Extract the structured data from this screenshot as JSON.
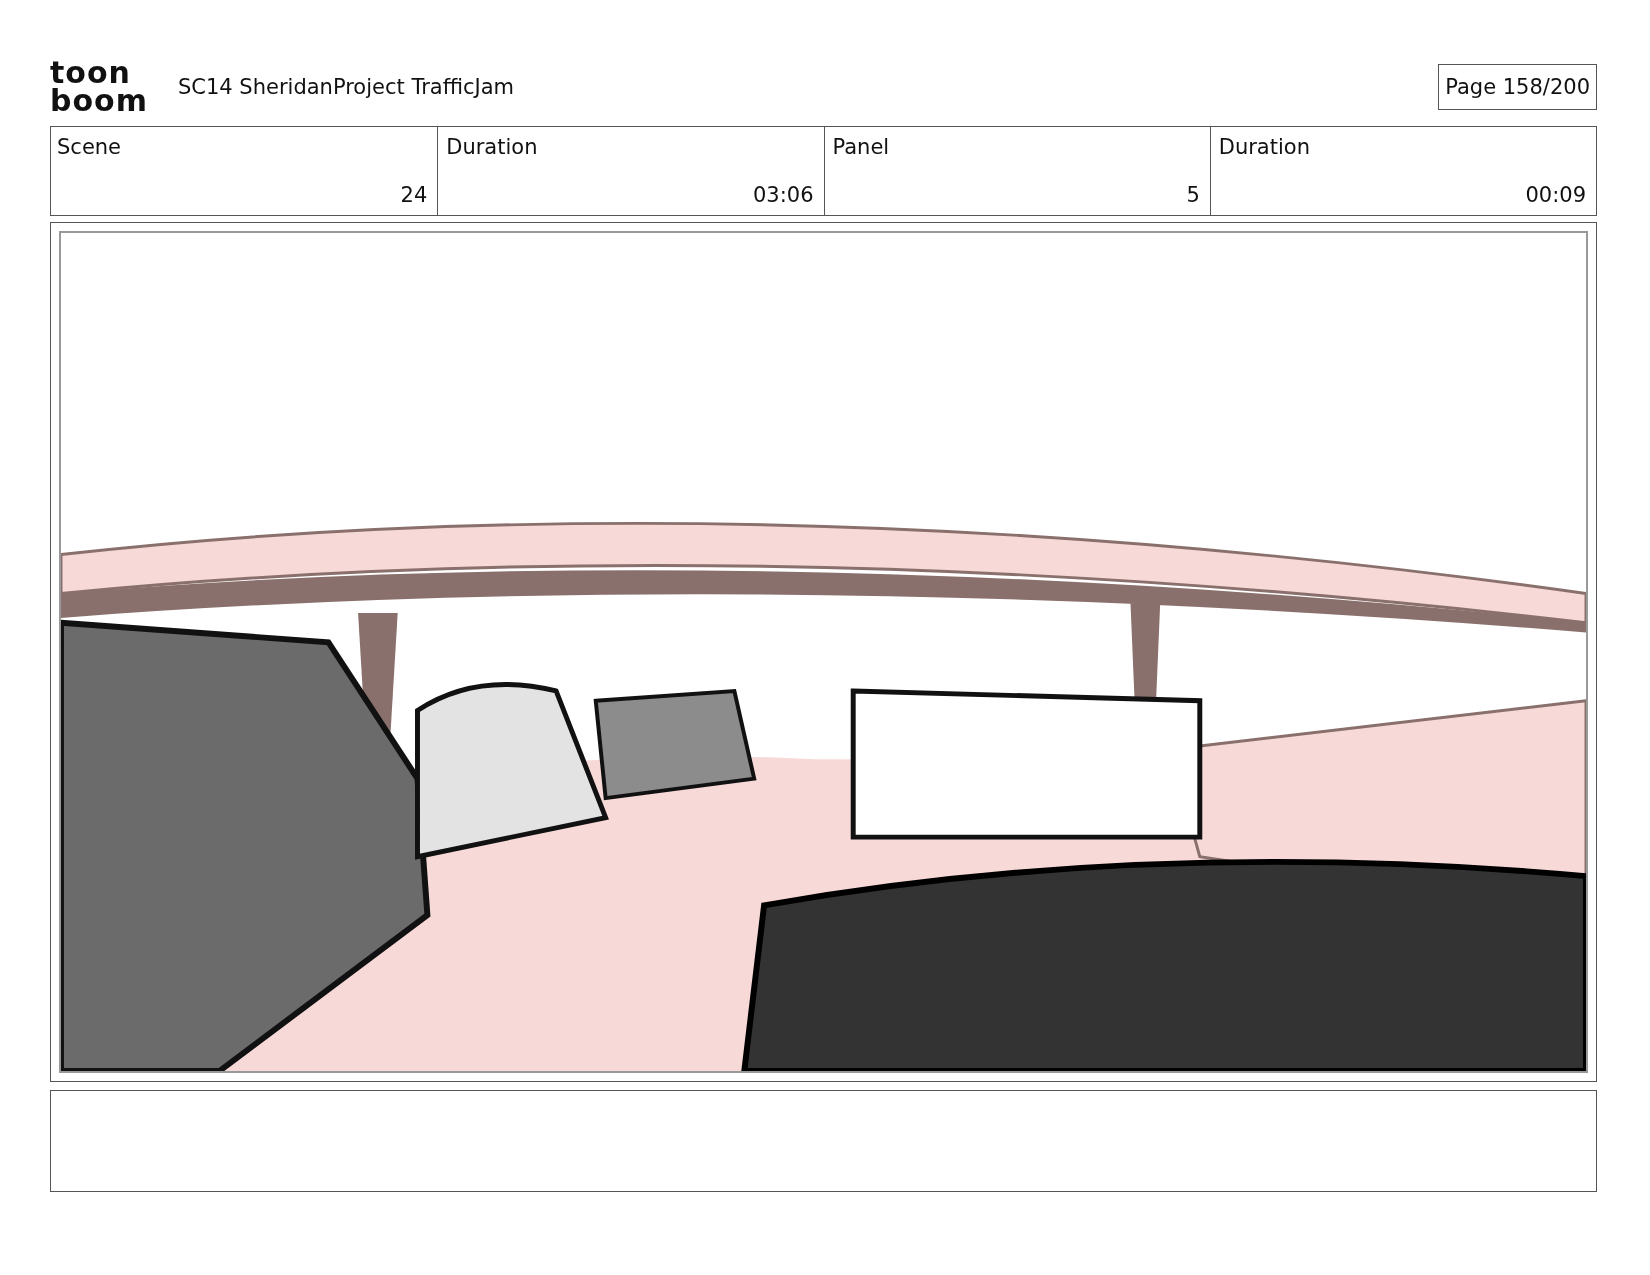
{
  "header": {
    "logo": [
      "toon",
      "boom"
    ],
    "title": "SC14 SheridanProject TrafficJam",
    "page": "Page 158/200"
  },
  "fields": [
    {
      "label": "Scene",
      "value": "24"
    },
    {
      "label": "Duration",
      "value": "03:06"
    },
    {
      "label": "Panel",
      "value": "5"
    },
    {
      "label": "Duration",
      "value": "00:09"
    }
  ]
}
